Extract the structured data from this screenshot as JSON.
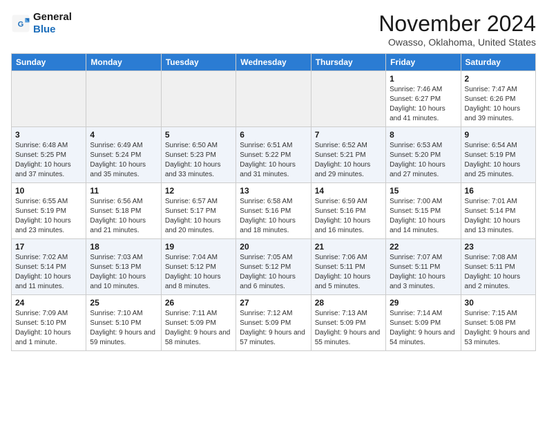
{
  "header": {
    "logo_line1": "General",
    "logo_line2": "Blue",
    "month_year": "November 2024",
    "location": "Owasso, Oklahoma, United States"
  },
  "weekdays": [
    "Sunday",
    "Monday",
    "Tuesday",
    "Wednesday",
    "Thursday",
    "Friday",
    "Saturday"
  ],
  "weeks": [
    [
      {
        "day": "",
        "info": ""
      },
      {
        "day": "",
        "info": ""
      },
      {
        "day": "",
        "info": ""
      },
      {
        "day": "",
        "info": ""
      },
      {
        "day": "",
        "info": ""
      },
      {
        "day": "1",
        "info": "Sunrise: 7:46 AM\nSunset: 6:27 PM\nDaylight: 10 hours and 41 minutes."
      },
      {
        "day": "2",
        "info": "Sunrise: 7:47 AM\nSunset: 6:26 PM\nDaylight: 10 hours and 39 minutes."
      }
    ],
    [
      {
        "day": "3",
        "info": "Sunrise: 6:48 AM\nSunset: 5:25 PM\nDaylight: 10 hours and 37 minutes."
      },
      {
        "day": "4",
        "info": "Sunrise: 6:49 AM\nSunset: 5:24 PM\nDaylight: 10 hours and 35 minutes."
      },
      {
        "day": "5",
        "info": "Sunrise: 6:50 AM\nSunset: 5:23 PM\nDaylight: 10 hours and 33 minutes."
      },
      {
        "day": "6",
        "info": "Sunrise: 6:51 AM\nSunset: 5:22 PM\nDaylight: 10 hours and 31 minutes."
      },
      {
        "day": "7",
        "info": "Sunrise: 6:52 AM\nSunset: 5:21 PM\nDaylight: 10 hours and 29 minutes."
      },
      {
        "day": "8",
        "info": "Sunrise: 6:53 AM\nSunset: 5:20 PM\nDaylight: 10 hours and 27 minutes."
      },
      {
        "day": "9",
        "info": "Sunrise: 6:54 AM\nSunset: 5:19 PM\nDaylight: 10 hours and 25 minutes."
      }
    ],
    [
      {
        "day": "10",
        "info": "Sunrise: 6:55 AM\nSunset: 5:19 PM\nDaylight: 10 hours and 23 minutes."
      },
      {
        "day": "11",
        "info": "Sunrise: 6:56 AM\nSunset: 5:18 PM\nDaylight: 10 hours and 21 minutes."
      },
      {
        "day": "12",
        "info": "Sunrise: 6:57 AM\nSunset: 5:17 PM\nDaylight: 10 hours and 20 minutes."
      },
      {
        "day": "13",
        "info": "Sunrise: 6:58 AM\nSunset: 5:16 PM\nDaylight: 10 hours and 18 minutes."
      },
      {
        "day": "14",
        "info": "Sunrise: 6:59 AM\nSunset: 5:16 PM\nDaylight: 10 hours and 16 minutes."
      },
      {
        "day": "15",
        "info": "Sunrise: 7:00 AM\nSunset: 5:15 PM\nDaylight: 10 hours and 14 minutes."
      },
      {
        "day": "16",
        "info": "Sunrise: 7:01 AM\nSunset: 5:14 PM\nDaylight: 10 hours and 13 minutes."
      }
    ],
    [
      {
        "day": "17",
        "info": "Sunrise: 7:02 AM\nSunset: 5:14 PM\nDaylight: 10 hours and 11 minutes."
      },
      {
        "day": "18",
        "info": "Sunrise: 7:03 AM\nSunset: 5:13 PM\nDaylight: 10 hours and 10 minutes."
      },
      {
        "day": "19",
        "info": "Sunrise: 7:04 AM\nSunset: 5:12 PM\nDaylight: 10 hours and 8 minutes."
      },
      {
        "day": "20",
        "info": "Sunrise: 7:05 AM\nSunset: 5:12 PM\nDaylight: 10 hours and 6 minutes."
      },
      {
        "day": "21",
        "info": "Sunrise: 7:06 AM\nSunset: 5:11 PM\nDaylight: 10 hours and 5 minutes."
      },
      {
        "day": "22",
        "info": "Sunrise: 7:07 AM\nSunset: 5:11 PM\nDaylight: 10 hours and 3 minutes."
      },
      {
        "day": "23",
        "info": "Sunrise: 7:08 AM\nSunset: 5:11 PM\nDaylight: 10 hours and 2 minutes."
      }
    ],
    [
      {
        "day": "24",
        "info": "Sunrise: 7:09 AM\nSunset: 5:10 PM\nDaylight: 10 hours and 1 minute."
      },
      {
        "day": "25",
        "info": "Sunrise: 7:10 AM\nSunset: 5:10 PM\nDaylight: 9 hours and 59 minutes."
      },
      {
        "day": "26",
        "info": "Sunrise: 7:11 AM\nSunset: 5:09 PM\nDaylight: 9 hours and 58 minutes."
      },
      {
        "day": "27",
        "info": "Sunrise: 7:12 AM\nSunset: 5:09 PM\nDaylight: 9 hours and 57 minutes."
      },
      {
        "day": "28",
        "info": "Sunrise: 7:13 AM\nSunset: 5:09 PM\nDaylight: 9 hours and 55 minutes."
      },
      {
        "day": "29",
        "info": "Sunrise: 7:14 AM\nSunset: 5:09 PM\nDaylight: 9 hours and 54 minutes."
      },
      {
        "day": "30",
        "info": "Sunrise: 7:15 AM\nSunset: 5:08 PM\nDaylight: 9 hours and 53 minutes."
      }
    ]
  ]
}
